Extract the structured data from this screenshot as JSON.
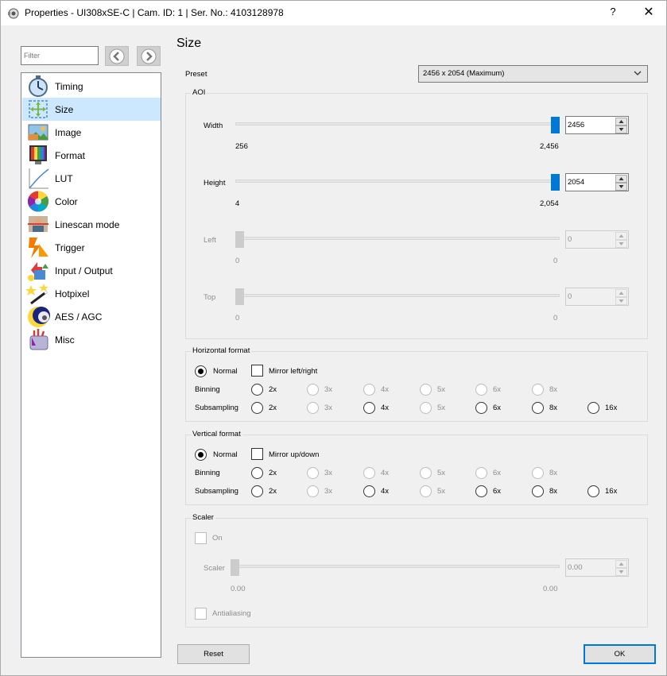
{
  "window": {
    "title": "Properties - UI308xSE-C | Cam. ID: 1 | Ser. No.: 4103128978",
    "help_label": "?",
    "close_label": "✕"
  },
  "filter": {
    "placeholder": "Filter"
  },
  "sidebar": {
    "items": [
      {
        "label": "Timing",
        "icon": "stopwatch-icon"
      },
      {
        "label": "Size",
        "icon": "size-icon",
        "selected": true
      },
      {
        "label": "Image",
        "icon": "image-icon"
      },
      {
        "label": "Format",
        "icon": "format-icon"
      },
      {
        "label": "LUT",
        "icon": "lut-icon"
      },
      {
        "label": "Color",
        "icon": "color-wheel-icon"
      },
      {
        "label": "Linescan mode",
        "icon": "linescan-icon"
      },
      {
        "label": "Trigger",
        "icon": "trigger-icon"
      },
      {
        "label": "Input / Output",
        "icon": "input-output-icon"
      },
      {
        "label": "Hotpixel",
        "icon": "hotpixel-icon"
      },
      {
        "label": "AES / AGC",
        "icon": "aes-agc-icon"
      },
      {
        "label": "Misc",
        "icon": "misc-icon"
      }
    ]
  },
  "page": {
    "title": "Size"
  },
  "preset": {
    "label": "Preset",
    "value": "2456 x 2054 (Maximum)"
  },
  "aoi": {
    "title": "AOI",
    "width": {
      "label": "Width",
      "min": "256",
      "max": "2,456",
      "value": "2456",
      "level": 1.0
    },
    "height": {
      "label": "Height",
      "min": "4",
      "max": "2,054",
      "value": "2054",
      "level": 1.0
    },
    "left": {
      "label": "Left",
      "min": "0",
      "max": "0",
      "value": "0",
      "level": 0.0
    },
    "top": {
      "label": "Top",
      "min": "0",
      "max": "0",
      "value": "0",
      "level": 0.0
    }
  },
  "horizontal": {
    "title": "Horizontal format",
    "normal": "Normal",
    "mirror": "Mirror left/right",
    "binning_label": "Binning",
    "subsampling_label": "Subsampling",
    "binning": [
      "2x",
      "3x",
      "4x",
      "5x",
      "6x",
      "8x"
    ],
    "subsampling": [
      "2x",
      "3x",
      "4x",
      "5x",
      "6x",
      "8x",
      "16x"
    ]
  },
  "vertical": {
    "title": "Vertical format",
    "normal": "Normal",
    "mirror": "Mirror up/down",
    "binning_label": "Binning",
    "subsampling_label": "Subsampling",
    "binning": [
      "2x",
      "3x",
      "4x",
      "5x",
      "6x",
      "8x"
    ],
    "subsampling": [
      "2x",
      "3x",
      "4x",
      "5x",
      "6x",
      "8x",
      "16x"
    ]
  },
  "scaler": {
    "title": "Scaler",
    "on_label": "On",
    "scaler_label": "Scaler",
    "min": "0.00",
    "max": "0.00",
    "value": "0.00",
    "antialiasing_label": "Antialiasing"
  },
  "buttons": {
    "reset": "Reset",
    "ok": "OK"
  },
  "colors": {
    "accent": "#0078d7",
    "selection": "#cce8ff"
  }
}
